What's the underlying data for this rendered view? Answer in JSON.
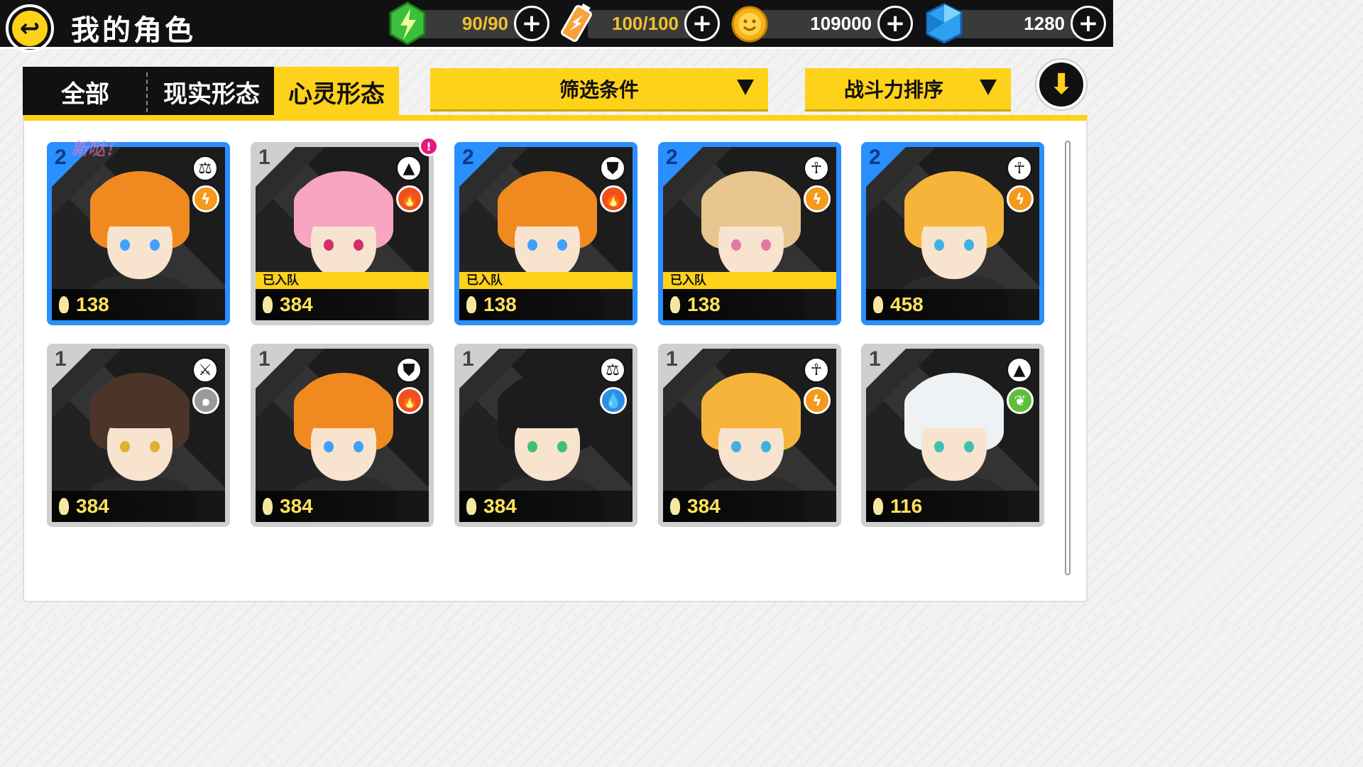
{
  "header": {
    "title": "我的角色",
    "back_icon": "back-arrow-icon",
    "resources": [
      {
        "name": "stamina",
        "icon": "lightning-gem-icon",
        "value": "90/90",
        "color": "#f0c030"
      },
      {
        "name": "energy",
        "icon": "battery-icon",
        "value": "100/100",
        "color": "#f0c030"
      },
      {
        "name": "coins",
        "icon": "gold-coin-icon",
        "value": "109000",
        "color": "#ffffff"
      },
      {
        "name": "diamonds",
        "icon": "blue-diamond-icon",
        "value": "1280",
        "color": "#ffffff"
      }
    ]
  },
  "tabs": [
    {
      "label": "全部",
      "active": false
    },
    {
      "label": "现实形态",
      "active": false
    },
    {
      "label": "心灵形态",
      "active": true
    }
  ],
  "filter": {
    "label": "筛选条件"
  },
  "sort": {
    "label": "战斗力排序"
  },
  "new_tag": "新哒！",
  "team_label": "已入队",
  "colors": {
    "accent": "#ffd21a",
    "rare_border": "#2a8fff",
    "common_border": "#cfcfcf"
  },
  "cards": [
    {
      "rank": "2",
      "power": "138",
      "role": "balance",
      "element": "lightning",
      "in_team": false,
      "hair": "#f08a20",
      "eyes": "#3fa0ff"
    },
    {
      "rank": "1",
      "power": "384",
      "role": "triangle",
      "element": "fire",
      "in_team": true,
      "hair": "#f7a5c0",
      "eyes": "#d0306a"
    },
    {
      "rank": "2",
      "power": "138",
      "role": "shield",
      "element": "fire",
      "in_team": true,
      "hair": "#f08a20",
      "eyes": "#3fa0ff"
    },
    {
      "rank": "2",
      "power": "138",
      "role": "ankh",
      "element": "lightning",
      "in_team": true,
      "hair": "#e9c58f",
      "eyes": "#e07aa0"
    },
    {
      "rank": "2",
      "power": "458",
      "role": "ankh",
      "element": "lightning",
      "in_team": false,
      "hair": "#f6b43a",
      "eyes": "#3fb0e0"
    },
    {
      "rank": "1",
      "power": "384",
      "role": "sword",
      "element": "wind",
      "in_team": false,
      "hair": "#4a3528",
      "eyes": "#e0b030"
    },
    {
      "rank": "1",
      "power": "384",
      "role": "shield",
      "element": "fire",
      "in_team": false,
      "hair": "#f08a20",
      "eyes": "#3fa0ff"
    },
    {
      "rank": "1",
      "power": "384",
      "role": "balance",
      "element": "water",
      "in_team": false,
      "hair": "#1c1c1c",
      "eyes": "#40c070"
    },
    {
      "rank": "1",
      "power": "384",
      "role": "ankh",
      "element": "lightning",
      "in_team": false,
      "hair": "#f6b43a",
      "eyes": "#3fb0e0"
    },
    {
      "rank": "1",
      "power": "116",
      "role": "triangle",
      "element": "leaf",
      "in_team": false,
      "hair": "#eef2f5",
      "eyes": "#40c0b0"
    }
  ]
}
